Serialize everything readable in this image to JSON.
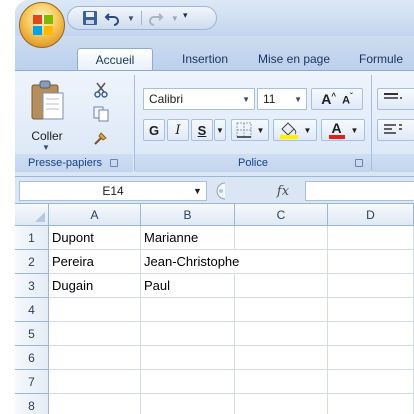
{
  "tabs": [
    "Accueil",
    "Insertion",
    "Mise en page",
    "Formule"
  ],
  "clipboard": {
    "paste_label": "Coller",
    "group_label": "Presse-papiers"
  },
  "font": {
    "name": "Calibri",
    "size": "11",
    "bold_label": "G",
    "italic_label": "I",
    "underline_label": "S",
    "group_label": "Police"
  },
  "formula_bar": {
    "name_box": "E14",
    "fx_label": "fx",
    "formula": ""
  },
  "columns": [
    "A",
    "B",
    "C",
    "D"
  ],
  "rows": [
    {
      "num": "1",
      "cells": [
        "Dupont",
        "Marianne",
        "",
        ""
      ]
    },
    {
      "num": "2",
      "cells": [
        "Pereira",
        "Jean-Christophe",
        "",
        ""
      ]
    },
    {
      "num": "3",
      "cells": [
        "Dugain",
        "Paul",
        "",
        ""
      ]
    },
    {
      "num": "4",
      "cells": [
        "",
        "",
        "",
        ""
      ]
    },
    {
      "num": "5",
      "cells": [
        "",
        "",
        "",
        ""
      ]
    },
    {
      "num": "6",
      "cells": [
        "",
        "",
        "",
        ""
      ]
    },
    {
      "num": "7",
      "cells": [
        "",
        "",
        "",
        ""
      ]
    },
    {
      "num": "8",
      "cells": [
        "",
        "",
        "",
        ""
      ]
    }
  ],
  "colors": {
    "window_frame": "#f4a23a",
    "ribbon": "#dbe6f5",
    "tab_text": "#17345f",
    "group_label_text": "#15428b",
    "font_color_bar": "#e0201a",
    "highlight_bar": "#ffef00"
  }
}
